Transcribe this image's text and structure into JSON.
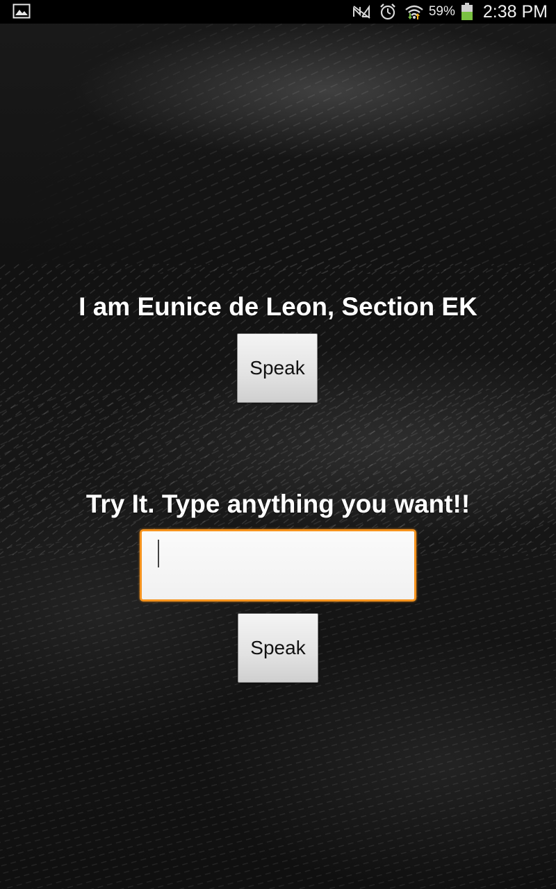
{
  "status_bar": {
    "battery_percent": "59%",
    "time": "2:38 PM",
    "icons": [
      "gallery-icon",
      "no-signal-icon",
      "alarm-icon",
      "wifi-icon",
      "battery-icon"
    ],
    "battery_color": "#7ac142"
  },
  "main": {
    "intro_text": "I am Eunice de Leon, Section EK",
    "speak_button_1_label": "Speak",
    "prompt_text": "Try It. Type anything you want!!",
    "text_input_value": "",
    "speak_button_2_label": "Speak"
  },
  "colors": {
    "input_focus_border": "#f5931e",
    "text": "#ffffff",
    "status_bar_bg": "#000000"
  }
}
